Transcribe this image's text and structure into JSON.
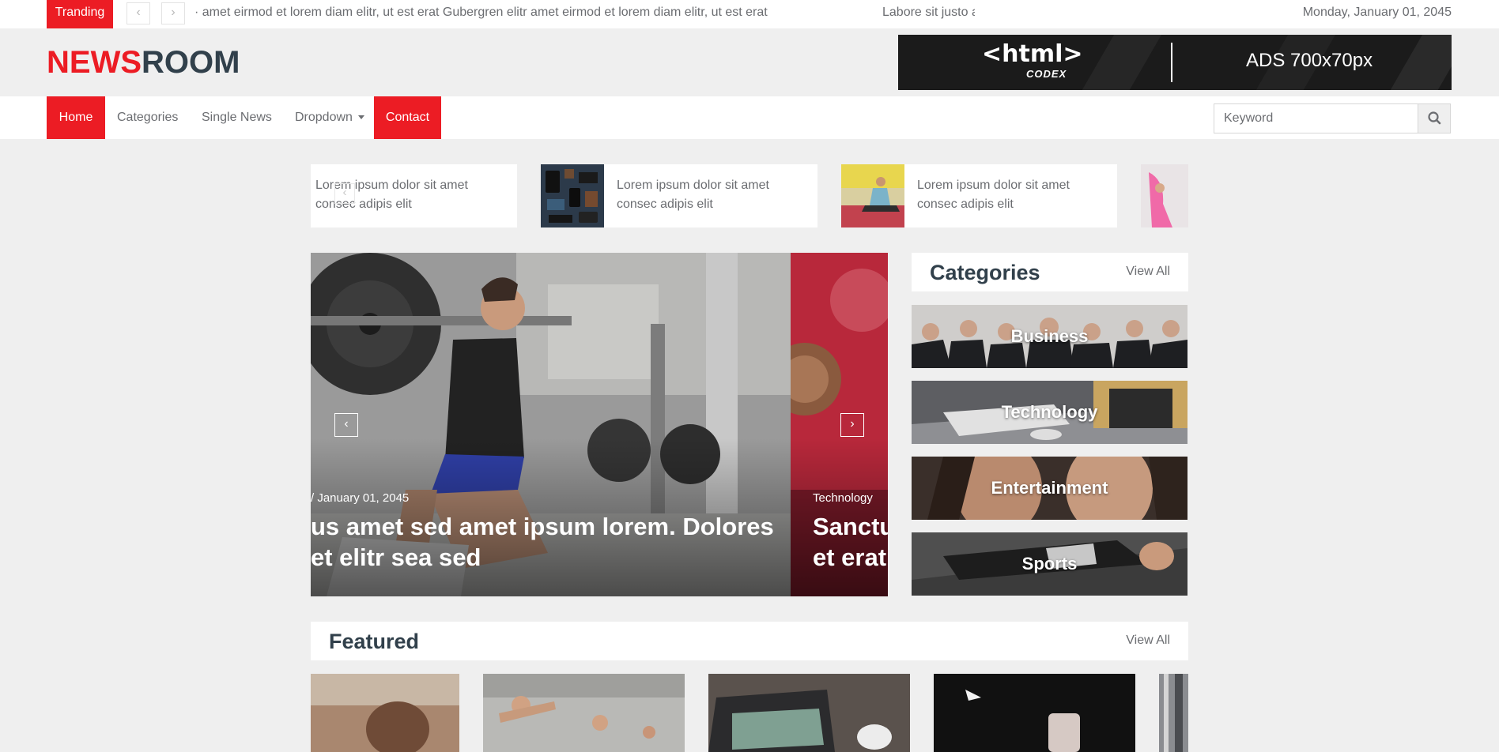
{
  "topbar": {
    "trending_label": "Tranding",
    "ticker_text_1": "· amet eirmod et lorem diam elitr, ut est erat Gubergren elitr amet eirmod et lorem diam elitr, ut est erat",
    "ticker_text_2": "Labore sit justo amet eos sed",
    "date": "Monday, January 01, 2045"
  },
  "brand": {
    "logo_red": "NEWS",
    "logo_dark": "ROOM",
    "ad_brand": "<html>",
    "ad_brand_sub": "CODEX",
    "ad_text": "ADS 700x70px"
  },
  "nav": {
    "items": [
      "Home",
      "Categories",
      "Single News",
      "Dropdown",
      "Contact"
    ],
    "search_placeholder": "Keyword"
  },
  "mini_news": [
    {
      "line1": "Lorem ipsum dolor sit amet",
      "line2": "consec adipis elit"
    },
    {
      "line1": "Lorem ipsum dolor sit amet",
      "line2": "consec adipis elit"
    },
    {
      "line1": "Lorem ipsum dolor sit amet",
      "line2": "consec adipis elit"
    }
  ],
  "hero": {
    "slide1": {
      "meta": "/   January 01, 2045",
      "line1": "us amet sed amet ipsum lorem. Dolores",
      "line2": " et elitr sea sed"
    },
    "slide2": {
      "meta": "Technology",
      "line1": "Sanctus",
      "line2": "et erat"
    }
  },
  "categories": {
    "title": "Categories",
    "view_all": "View All",
    "items": [
      "Business",
      "Technology",
      "Entertainment",
      "Sports"
    ]
  },
  "featured": {
    "title": "Featured",
    "view_all": "View All"
  },
  "colors": {
    "accent": "#ec1c24",
    "dark": "#31404b",
    "muted": "#6b6d71",
    "background": "#efefef"
  }
}
